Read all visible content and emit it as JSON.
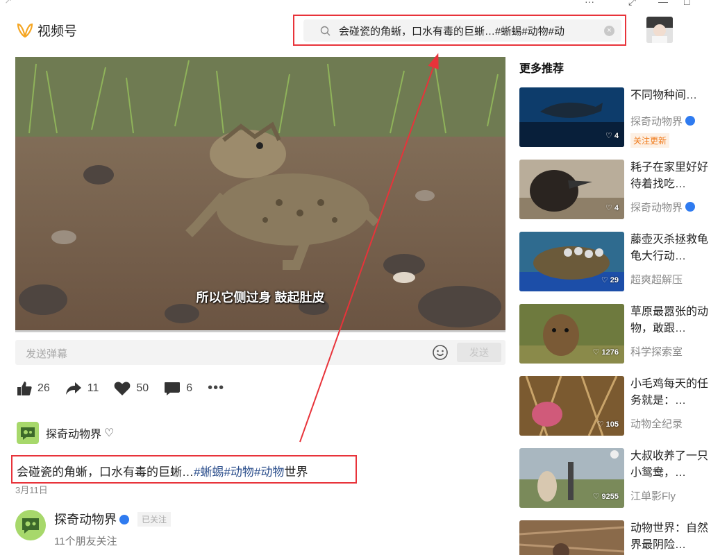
{
  "app": {
    "name": "视频号"
  },
  "window": {
    "back_glyph": "↗",
    "menu_glyph": "···",
    "ctrl_glyphs": [
      "⤢",
      "—",
      "□"
    ]
  },
  "search": {
    "query": "会碰瓷的角蜥，口水有毒的巨蜥…#蜥蜴#动物#动",
    "clear_glyph": "×"
  },
  "video": {
    "subtitle": "所以它侧过身 鼓起肚皮"
  },
  "danmu": {
    "placeholder": "发送弹幕",
    "send_label": "发送"
  },
  "actions": [
    {
      "name": "like",
      "count": "26"
    },
    {
      "name": "share",
      "count": "11"
    },
    {
      "name": "favorite",
      "count": "50"
    },
    {
      "name": "comment",
      "count": "6"
    }
  ],
  "more_label": "•••",
  "author": {
    "name": "探奇动物界",
    "description_prefix": "会碰瓷的角蜥，口水有毒的巨蜥…",
    "tags": [
      "#蜥蜴",
      "#动物",
      "#动物"
    ],
    "description_suffix": "世界",
    "date": "3月11日",
    "followed_label": "已关注",
    "friends_text": "11个朋友关注"
  },
  "sidebar": {
    "title": "更多推荐",
    "items": [
      {
        "title": "不同物种间…",
        "author": "探奇动物界",
        "verified": true,
        "likes": "4",
        "badge": "关注更新"
      },
      {
        "title": "耗子在家里好好待着找吃…",
        "author": "探奇动物界",
        "verified": true,
        "likes": "4"
      },
      {
        "title": "藤壶灭杀拯救龟龟大行动…",
        "author": "超爽超解压",
        "likes": "29"
      },
      {
        "title": "草原最嚣张的动物，敢跟…",
        "author": "科学探索室",
        "likes": "1276"
      },
      {
        "title": "小毛鸡每天的任务就是：…",
        "author": "动物全纪录",
        "likes": "105"
      },
      {
        "title": "大叔收养了一只小鸳鸯，…",
        "author": "江单影Fly",
        "likes": "9255"
      },
      {
        "title": "动物世界：自然界最阴险…",
        "author": "",
        "likes": ""
      }
    ]
  },
  "colors": {
    "accent": "#e8333a",
    "tag": "#2b4e8c",
    "verified": "#2f7bf0",
    "logo": "#f5a623"
  }
}
